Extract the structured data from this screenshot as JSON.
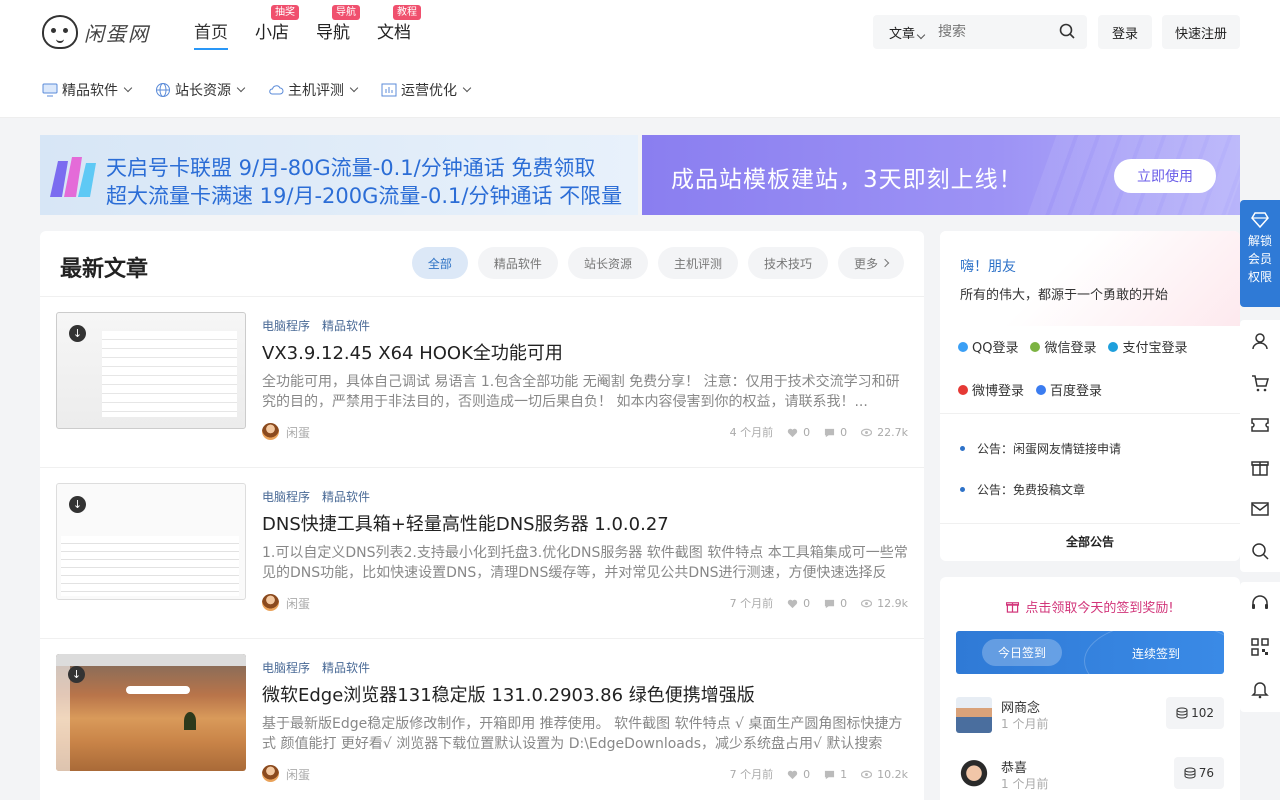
{
  "header": {
    "logo_text": "闲蛋网",
    "nav": [
      {
        "label": "首页",
        "badge": ""
      },
      {
        "label": "小店",
        "badge": "抽奖"
      },
      {
        "label": "导航",
        "badge": "导航"
      },
      {
        "label": "文档",
        "badge": "教程"
      }
    ],
    "search": {
      "type": "文章",
      "placeholder": "搜索"
    },
    "login": "登录",
    "register": "快速注册"
  },
  "subnav": [
    {
      "label": "精品软件",
      "icon": "monitor-icon"
    },
    {
      "label": "站长资源",
      "icon": "globe-icon"
    },
    {
      "label": "主机评测",
      "icon": "cloud-icon"
    },
    {
      "label": "运营优化",
      "icon": "chart-icon"
    }
  ],
  "banners": {
    "left": {
      "line1": "天启号卡联盟    9/月-80G流量-0.1/分钟通话   免费领取",
      "line2": "超大流量卡满速 19/月-200G流量-0.1/分钟通话     不限量"
    },
    "right": {
      "text": "成品站模板建站，3天即刻上线！",
      "cta": "立即使用"
    }
  },
  "main": {
    "title": "最新文章",
    "tabs": [
      "全部",
      "精品软件",
      "站长资源",
      "主机评测",
      "技术技巧",
      "更多"
    ],
    "posts": [
      {
        "cats": [
          "电脑程序",
          "精品软件"
        ],
        "title": "VX3.9.12.45 X64 HOOK全功能可用",
        "excerpt": "全功能可用，具体自己调试 易语言 1.包含全部功能 无阉割 免费分享！ 注意：仅用于技术交流学习和研究的目的，严禁用于非法目的，否则造成一切后果自负！ 如本内容侵害到你的权益，请联系我！...",
        "author": "闲蛋",
        "time": "4 个月前",
        "likes": "0",
        "comments": "0",
        "views": "22.7k"
      },
      {
        "cats": [
          "电脑程序",
          "精品软件"
        ],
        "title": "DNS快捷工具箱+轻量高性能DNS服务器 1.0.0.27",
        "excerpt": "1.可以自定义DNS列表2.支持最小化到托盘3.优化DNS服务器 软件截图 软件特点 本工具箱集成可一些常见的DNS功能，比如快速设置DNS，清理DNS缓存等，并对常见公共DNS进行测速，方便快速选择反应…",
        "author": "闲蛋",
        "time": "7 个月前",
        "likes": "0",
        "comments": "0",
        "views": "12.9k"
      },
      {
        "cats": [
          "电脑程序",
          "精品软件"
        ],
        "title": "微软Edge浏览器131稳定版 131.0.2903.86 绿色便携增强版",
        "excerpt": "基于最新版Edge稳定版修改制作，开箱即用 推荐使用。 软件截图 软件特点 √ 桌面生产圆角图标快捷方式 颜值能打 更好看√ 浏览器下载位置默认设置为 D:\\EdgeDownloads，减少系统盘占用√ 默认搜索引…",
        "author": "闲蛋",
        "time": "7 个月前",
        "likes": "0",
        "comments": "1",
        "views": "10.2k"
      }
    ]
  },
  "sidebar": {
    "greeting": "嗨！朋友",
    "slogan": "所有的伟大，都源于一个勇敢的开始",
    "logins": [
      {
        "label": "QQ登录",
        "color": "#3a9ff5"
      },
      {
        "label": "微信登录",
        "color": "#7cb342"
      },
      {
        "label": "支付宝登录",
        "color": "#1e9fdc"
      },
      {
        "label": "微博登录",
        "color": "#e53935"
      },
      {
        "label": "百度登录",
        "color": "#3b7cf0"
      }
    ],
    "notices": [
      "公告：闲蛋网友情链接申请",
      "公告：免费投稿文章"
    ],
    "all_notices": "全部公告",
    "sign": {
      "tip": "点击领取今天的签到奖励!",
      "today": "今日签到",
      "streak": "连续签到",
      "users": [
        {
          "name": "网商念",
          "time": "1 个月前",
          "coins": "102"
        },
        {
          "name": "恭喜",
          "time": "1 个月前",
          "coins": "76"
        }
      ]
    }
  },
  "rightbar": {
    "unlock": "解锁会员权限"
  }
}
